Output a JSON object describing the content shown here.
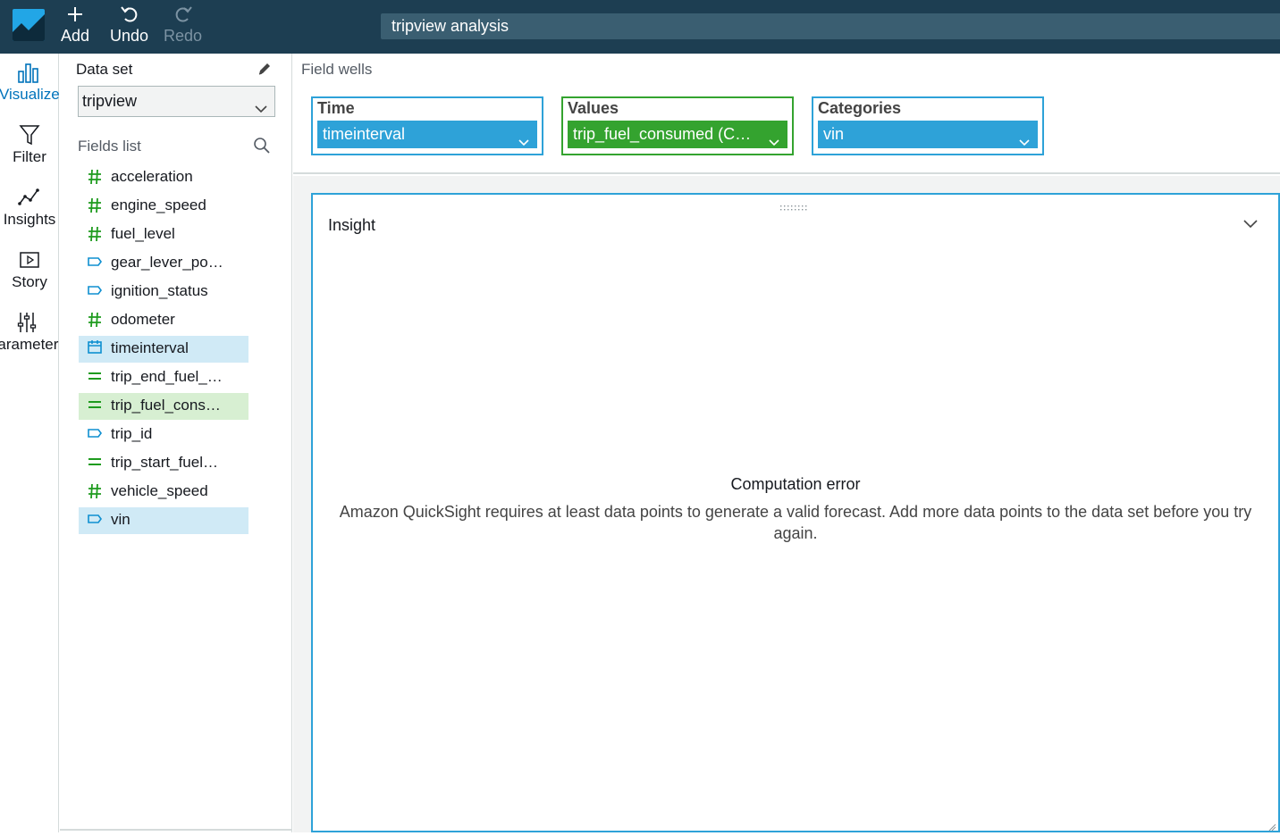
{
  "toolbar": {
    "add_label": "Add",
    "undo_label": "Undo",
    "redo_label": "Redo",
    "analysis_title": "tripview analysis"
  },
  "rail": {
    "items": [
      {
        "label": "Visualize",
        "icon": "bar-chart-icon"
      },
      {
        "label": "Filter",
        "icon": "funnel-icon"
      },
      {
        "label": "Insights",
        "icon": "insights-line-icon"
      },
      {
        "label": "Story",
        "icon": "story-play-icon"
      },
      {
        "label": "Parameters",
        "icon": "sliders-icon"
      }
    ]
  },
  "dataset": {
    "label": "Data set",
    "selected": "tripview"
  },
  "fields": {
    "label": "Fields list",
    "items": [
      {
        "name": "acceleration",
        "type": "measure-number"
      },
      {
        "name": "engine_speed",
        "type": "measure-number"
      },
      {
        "name": "fuel_level",
        "type": "measure-number"
      },
      {
        "name": "gear_lever_po…",
        "type": "dimension-string"
      },
      {
        "name": "ignition_status",
        "type": "dimension-string"
      },
      {
        "name": "odometer",
        "type": "measure-number"
      },
      {
        "name": "timeinterval",
        "type": "date",
        "selected": "blue"
      },
      {
        "name": "trip_end_fuel_…",
        "type": "calculated"
      },
      {
        "name": "trip_fuel_cons…",
        "type": "calculated",
        "selected": "green"
      },
      {
        "name": "trip_id",
        "type": "dimension-string"
      },
      {
        "name": "trip_start_fuel…",
        "type": "calculated"
      },
      {
        "name": "vehicle_speed",
        "type": "measure-number"
      },
      {
        "name": "vin",
        "type": "dimension-string",
        "selected": "blue"
      }
    ]
  },
  "field_wells": {
    "label": "Field wells",
    "time": {
      "title": "Time",
      "value": "timeinterval"
    },
    "values": {
      "title": "Values",
      "value": "trip_fuel_consumed (C…"
    },
    "categories": {
      "title": "Categories",
      "value": "vin"
    }
  },
  "visual": {
    "title": "Insight",
    "error_title": "Computation error",
    "error_message": "Amazon QuickSight requires at least data points to generate a valid forecast. Add more data points to the data set before you try again."
  },
  "colors": {
    "topbar": "#1d3e52",
    "accent_blue": "#2ea2d8",
    "accent_green": "#34a32f",
    "measure_green": "#1e9b1e",
    "dimension_blue": "#0e8fd0"
  }
}
